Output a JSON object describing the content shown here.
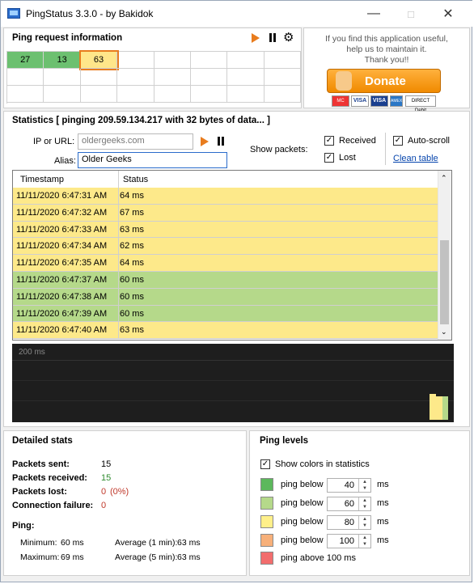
{
  "window": {
    "title": "PingStatus 3.3.0 - by Bakidok"
  },
  "ping_request": {
    "header": "Ping request information",
    "cells": [
      {
        "value": "27",
        "color": "#6cc070"
      },
      {
        "value": "13",
        "color": "#6cc070"
      },
      {
        "value": "63",
        "color": "#ffe68a"
      }
    ]
  },
  "donate": {
    "message_line1": "If you find this application useful,",
    "message_line2": "help us to maintain it.",
    "message_line3": "Thank you!!",
    "button_label": "Donate",
    "card_mastercard": "MC",
    "card_visa": "VISA",
    "card_visa2": "VISA",
    "card_amex": "AMEX",
    "card_direct": "DIRECT Debit"
  },
  "statistics": {
    "header": "Statistics  [ pinging 209.59.134.217 with 32 bytes of data... ]",
    "ip_label": "IP or URL:",
    "ip_value": "oldergeeks.com",
    "alias_label": "Alias:",
    "alias_value": "Older Geeks",
    "show_packets_label": "Show packets:",
    "received_label": "Received",
    "lost_label": "Lost",
    "autoscroll_label": "Auto-scroll",
    "clean_table_label": "Clean table"
  },
  "table": {
    "col_timestamp": "Timestamp",
    "col_status": "Status",
    "rows": [
      {
        "ts": "11/11/2020  6:47:31 AM",
        "status": "64 ms",
        "color": "#fde98a"
      },
      {
        "ts": "11/11/2020  6:47:32 AM",
        "status": "67 ms",
        "color": "#fde98a"
      },
      {
        "ts": "11/11/2020  6:47:33 AM",
        "status": "63 ms",
        "color": "#fde98a"
      },
      {
        "ts": "11/11/2020  6:47:34 AM",
        "status": "62 ms",
        "color": "#fde98a"
      },
      {
        "ts": "11/11/2020  6:47:35 AM",
        "status": "64 ms",
        "color": "#fde98a"
      },
      {
        "ts": "11/11/2020  6:47:37 AM",
        "status": "60 ms",
        "color": "#b5d98a"
      },
      {
        "ts": "11/11/2020  6:47:38 AM",
        "status": "60 ms",
        "color": "#b5d98a"
      },
      {
        "ts": "11/11/2020  6:47:39 AM",
        "status": "60 ms",
        "color": "#b5d98a"
      },
      {
        "ts": "11/11/2020  6:47:40 AM",
        "status": "63 ms",
        "color": "#fde98a"
      }
    ]
  },
  "graph": {
    "max_label": "200 ms"
  },
  "detailed_stats": {
    "header": "Detailed stats",
    "sent_label": "Packets sent:",
    "sent_value": "15",
    "received_label": "Packets received:",
    "received_value": "15",
    "lost_label": "Packets lost:",
    "lost_value": "0",
    "lost_pct": "(0%)",
    "failure_label": "Connection failure:",
    "failure_value": "0",
    "ping_label": "Ping:",
    "min_label": "Minimum:",
    "min_value": "60 ms",
    "max_label": "Maximum:",
    "max_value": "69 ms",
    "avg1_label": "Average (1 min):",
    "avg1_value": "63 ms",
    "avg5_label": "Average (5 min):",
    "avg5_value": "63 ms"
  },
  "ping_levels": {
    "header": "Ping levels",
    "show_colors_label": "Show colors in statistics",
    "levels": [
      {
        "label": "ping below",
        "value": "40",
        "unit": "ms",
        "color": "#5cb85c"
      },
      {
        "label": "ping below",
        "value": "60",
        "unit": "ms",
        "color": "#b5d98a"
      },
      {
        "label": "ping below",
        "value": "80",
        "unit": "ms",
        "color": "#fff08a"
      },
      {
        "label": "ping below",
        "value": "100",
        "unit": "ms",
        "color": "#f7b07a"
      }
    ],
    "above_label": "ping above 100 ms",
    "above_color": "#f26d6d"
  }
}
